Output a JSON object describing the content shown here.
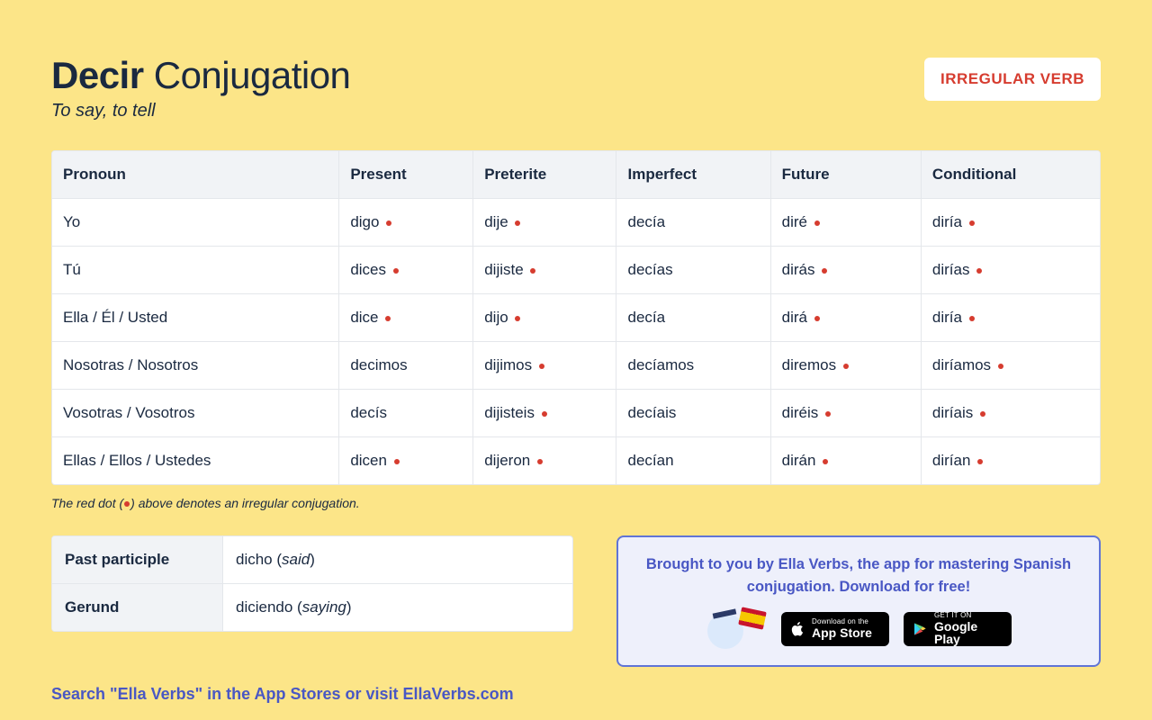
{
  "header": {
    "verb": "Decir",
    "conj_label": "Conjugation",
    "subtitle": "To say, to tell",
    "badge": "IRREGULAR VERB"
  },
  "table": {
    "headers": [
      "Pronoun",
      "Present",
      "Preterite",
      "Imperfect",
      "Future",
      "Conditional"
    ],
    "rows": [
      {
        "pronoun": "Yo",
        "present": {
          "t": "digo",
          "irr": true
        },
        "preterite": {
          "t": "dije",
          "irr": true
        },
        "imperfect": {
          "t": "decía",
          "irr": false
        },
        "future": {
          "t": "diré",
          "irr": true
        },
        "conditional": {
          "t": "diría",
          "irr": true
        }
      },
      {
        "pronoun": "Tú",
        "present": {
          "t": "dices",
          "irr": true
        },
        "preterite": {
          "t": "dijiste",
          "irr": true
        },
        "imperfect": {
          "t": "decías",
          "irr": false
        },
        "future": {
          "t": "dirás",
          "irr": true
        },
        "conditional": {
          "t": "dirías",
          "irr": true
        }
      },
      {
        "pronoun": "Ella / Él / Usted",
        "present": {
          "t": "dice",
          "irr": true
        },
        "preterite": {
          "t": "dijo",
          "irr": true
        },
        "imperfect": {
          "t": "decía",
          "irr": false
        },
        "future": {
          "t": "dirá",
          "irr": true
        },
        "conditional": {
          "t": "diría",
          "irr": true
        }
      },
      {
        "pronoun": "Nosotras / Nosotros",
        "present": {
          "t": "decimos",
          "irr": false
        },
        "preterite": {
          "t": "dijimos",
          "irr": true
        },
        "imperfect": {
          "t": "decíamos",
          "irr": false
        },
        "future": {
          "t": "diremos",
          "irr": true
        },
        "conditional": {
          "t": "diríamos",
          "irr": true
        }
      },
      {
        "pronoun": "Vosotras / Vosotros",
        "present": {
          "t": "decís",
          "irr": false
        },
        "preterite": {
          "t": "dijisteis",
          "irr": true
        },
        "imperfect": {
          "t": "decíais",
          "irr": false
        },
        "future": {
          "t": "diréis",
          "irr": true
        },
        "conditional": {
          "t": "diríais",
          "irr": true
        }
      },
      {
        "pronoun": "Ellas / Ellos / Ustedes",
        "present": {
          "t": "dicen",
          "irr": true
        },
        "preterite": {
          "t": "dijeron",
          "irr": true
        },
        "imperfect": {
          "t": "decían",
          "irr": false
        },
        "future": {
          "t": "dirán",
          "irr": true
        },
        "conditional": {
          "t": "dirían",
          "irr": true
        }
      }
    ]
  },
  "footnote": {
    "pre": "The red dot (",
    "post": ") above denotes an irregular conjugation."
  },
  "participles": {
    "past_label": "Past participle",
    "past_value": "dicho",
    "past_translation": "said",
    "gerund_label": "Gerund",
    "gerund_value": "diciendo",
    "gerund_translation": "saying"
  },
  "promo": {
    "text": "Brought to you by Ella Verbs, the app for mastering Spanish conjugation. Download for free!",
    "appstore_tiny": "Download on the",
    "appstore_big": "App Store",
    "play_tiny": "GET IT ON",
    "play_big": "Google Play"
  },
  "caption": {
    "pre": "Search \"Ella Verbs\" in the App Stores or ",
    "link": "visit EllaVerbs.com"
  }
}
